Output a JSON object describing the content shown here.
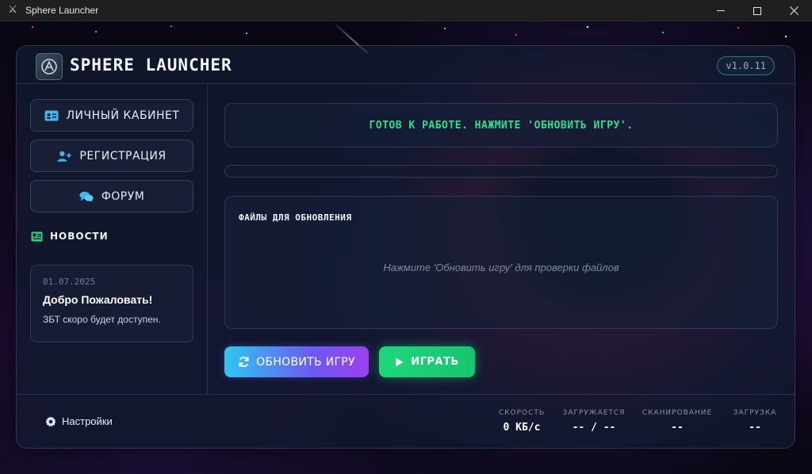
{
  "window": {
    "title": "Sphere Launcher"
  },
  "header": {
    "brand": "SPHERE LAUNCHER",
    "version": "v1.0.11"
  },
  "sidebar": {
    "items": [
      {
        "label": "ЛИЧНЫЙ КАБИНЕТ",
        "icon": "id-card-icon"
      },
      {
        "label": "РЕГИСТРАЦИЯ",
        "icon": "user-plus-icon"
      },
      {
        "label": "ФОРУМ",
        "icon": "comments-icon"
      }
    ],
    "news_title": "НОВОСТИ",
    "news": [
      {
        "date": "01.07.2025",
        "title": "Добро Пожаловать!",
        "body": "ЗБТ скоро будет доступен."
      }
    ]
  },
  "main": {
    "status": "ГОТОВ К РАБОТЕ. НАЖМИТЕ 'ОБНОВИТЬ ИГРУ'.",
    "progress": 0,
    "files_title": "ФАЙЛЫ ДЛЯ ОБНОВЛЕНИЯ",
    "files_empty": "Нажмите 'Обновить игру' для проверки файлов",
    "update_label": "ОБНОВИТЬ ИГРУ",
    "play_label": "ИГРАТЬ"
  },
  "footer": {
    "settings_label": "Настройки",
    "stats": [
      {
        "label": "СКОРОСТЬ",
        "value": "0 КБ/с"
      },
      {
        "label": "ЗАГРУЖАЕТСЯ",
        "value": "-- / --"
      },
      {
        "label": "СКАНИРОВАНИЕ",
        "value": "--"
      },
      {
        "label": "ЗАГРУЗКА",
        "value": "--"
      }
    ]
  },
  "colors": {
    "accent_green": "#2be08a",
    "accent_cyan": "#2ec6f2",
    "accent_purple": "#9b3ff0"
  }
}
